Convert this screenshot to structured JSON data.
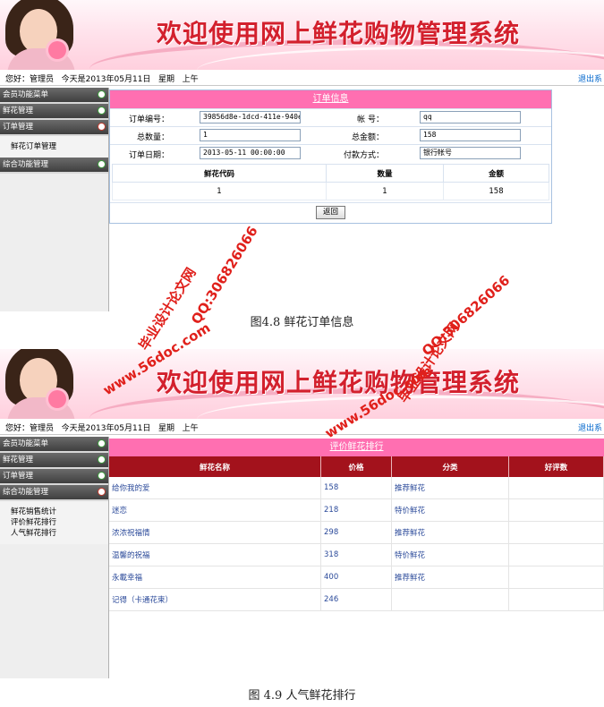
{
  "app": {
    "title": "欢迎使用网上鲜花购物管理系统"
  },
  "infobar": {
    "user_label": "您好：管理员",
    "today_label": "今天是2013年05月11日",
    "weekday_label": "星期",
    "ampm": "上午",
    "logout": "退出系"
  },
  "menu": {
    "member": "会员功能菜单",
    "flower": "鲜花管理",
    "order": "订单管理",
    "comprehensive": "综合功能管理",
    "order_items": [
      "鲜花订单管理"
    ],
    "comprehensive_items": [
      "鲜花销售统计",
      "评价鲜花排行",
      "人气鲜花排行"
    ]
  },
  "order_info": {
    "title": "订单信息",
    "order_no_label": "订单编号：",
    "order_no": "39856d8e-1dcd-411e-940e",
    "account_label": "帐      号：",
    "account": "qq",
    "quantity_label": "总数量：",
    "quantity": "1",
    "amount_label": "总金额：",
    "amount": "158",
    "date_label": "订单日期：",
    "date": "2013-05-11 00:00:00",
    "payment_label": "付款方式：",
    "payment": "银行帐号",
    "columns": [
      "鲜花代码",
      "数量",
      "金额"
    ],
    "rows": [
      [
        "1",
        "1",
        "158"
      ]
    ],
    "back_button": "返回"
  },
  "ranking": {
    "title": "评价鲜花排行",
    "columns": [
      "鲜花名称",
      "价格",
      "分类",
      "好评数"
    ],
    "rows": [
      [
        "给你我的爱",
        "158",
        "推荐鲜花",
        ""
      ],
      [
        "迷恋",
        "218",
        "特价鲜花",
        ""
      ],
      [
        "浓浓祝福情",
        "298",
        "推荐鲜花",
        ""
      ],
      [
        "温馨的祝福",
        "318",
        "特价鲜花",
        ""
      ],
      [
        "永載幸福",
        "400",
        "推荐鲜花",
        ""
      ],
      [
        "记得（卡通花束）",
        "246",
        "",
        ""
      ]
    ]
  },
  "captions": {
    "fig1": "图4.8 鲜花订单信息",
    "fig2": "图 4.9 人气鲜花排行"
  },
  "watermarks": {
    "site": "www.56doc.com",
    "qq": "QQ:306826066",
    "brand": "毕业设计论文网"
  },
  "colors": {
    "banner_title": "#d3202d",
    "pink_header": "#ff6fb1",
    "ranking_header": "#a3121c",
    "menu_header": "#4a4a4a"
  }
}
